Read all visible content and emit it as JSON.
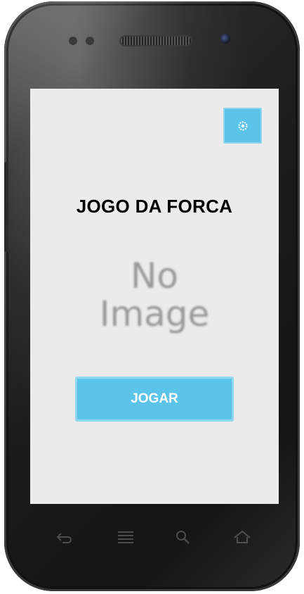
{
  "app": {
    "title": "JOGO DA FORCA",
    "play_label": "JOGAR",
    "image_placeholder": {
      "line1": "No",
      "line2": "Image"
    }
  },
  "toolbar": {
    "settings_icon": "gear-icon"
  },
  "device_nav": {
    "keys": [
      "back-icon",
      "menu-icon",
      "search-icon",
      "home-icon"
    ]
  },
  "colors": {
    "accent": "#5bc4e8",
    "accent_border": "#8fd6ef",
    "screen_bg": "#ebebeb",
    "title_text": "#000000",
    "button_text": "#ffffff"
  }
}
